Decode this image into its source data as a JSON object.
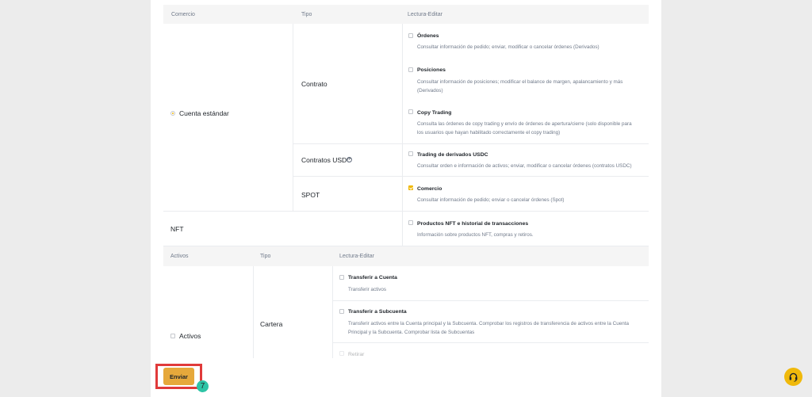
{
  "trading_table": {
    "headers": {
      "commerce": "Comercio",
      "type": "Tipo",
      "rw": "Lectura-Editar"
    },
    "standard_account": {
      "label": "Cuenta estándar",
      "selected": true
    },
    "contract_type": "Contrato",
    "usdc_type": "Contratos USDC",
    "spot_type": "SPOT",
    "nft_label": "NFT",
    "permissions": {
      "orders": {
        "title": "Órdenes",
        "desc": "Consultar información de pedido; enviar, modificar o cancelar órdenes (Derivados)",
        "checked": false
      },
      "positions": {
        "title": "Posiciones",
        "desc_1": "Consultar información de posiciones; modificar el balance de margen, apalancamiento y más",
        "desc_2": "(Derivados)",
        "checked": false
      },
      "copy": {
        "title": "Copy Trading",
        "desc_1": "Consulta las órdenes de copy trading y envío de órdenes de apertura/cierre (solo disponible para",
        "desc_2": "los usuarios que hayan habilitado correctamente el copy trading)",
        "checked": false
      },
      "usdc": {
        "title": "Trading de derivados USDC",
        "desc": "Consultar orden e información de activos; enviar, modificar o cancelar órdenes (contratos USDC)",
        "checked": false
      },
      "spot": {
        "title": "Comercio",
        "desc": "Consultar información de pedido; enviar o cancelar órdenes (Spot)",
        "checked": true
      },
      "nft": {
        "title": "Productos NFT e historial de transacciones",
        "desc": "Información sobre productos NFT, compras y retiros.",
        "checked": false
      }
    }
  },
  "assets_table": {
    "headers": {
      "assets": "Activos",
      "type": "Tipo",
      "rw": "Lectura-Editar"
    },
    "assets_label": "Activos",
    "wallet_type": "Cartera",
    "permissions": {
      "transfer_account": {
        "title": "Transferir a Cuenta",
        "desc": "Transferir activos",
        "checked": false
      },
      "transfer_sub": {
        "title": "Transferir a Subcuenta",
        "desc_1": "Transferir activos entre la Cuenta principal y la Subcuenta. Comprobar los registros de transferencia de activos entre la Cuenta",
        "desc_2": "Principal y la Subcuenta. Comprobar lista de Subcuentas",
        "checked": false
      },
      "withdraw": {
        "title": "Retirar",
        "checked": false
      }
    }
  },
  "submit_label": "Enviar",
  "step_number": "7",
  "colors": {
    "accent": "#f0b90b",
    "button": "#e6a83b",
    "highlight": "#e03a3a",
    "badge": "#2ec4a6"
  }
}
